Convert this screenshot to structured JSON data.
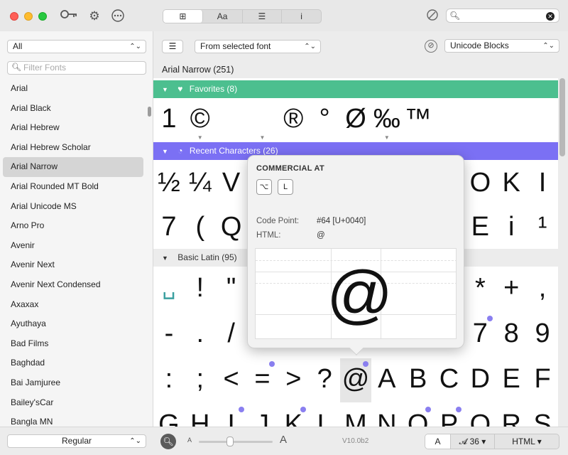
{
  "toolbar": {
    "segments": [
      "⊞",
      "Aa",
      "☰",
      "i"
    ],
    "search_value": ""
  },
  "sidebar": {
    "collection": "All",
    "filter_placeholder": "Filter Fonts",
    "fonts": [
      "Arial",
      "Arial Black",
      "Arial Hebrew",
      "Arial Hebrew Scholar",
      "Arial Narrow",
      "Arial Rounded MT Bold",
      "Arial Unicode MS",
      "Arno Pro",
      "Avenir",
      "Avenir Next",
      "Avenir Next Condensed",
      "Axaxax",
      "Ayuthaya",
      "Bad Films",
      "Baghdad",
      "Bai Jamjuree",
      "Bailey'sCar",
      "Bangla MN"
    ],
    "selected_index": 4,
    "style": "Regular"
  },
  "main": {
    "source": "From selected font",
    "blocks": "Unicode Blocks",
    "font_title": "Arial Narrow (251)",
    "sections": {
      "favorites": "Favorites (8)",
      "recent": "Recent Characters (26)",
      "basic": "Basic Latin (95)"
    },
    "fav_row": [
      "1",
      "©",
      "",
      "",
      "®",
      "°",
      "Ø",
      "‰",
      "™",
      "",
      "",
      "",
      ""
    ],
    "recent_row1": [
      "½",
      "¼",
      "V",
      "",
      "",
      "",
      "",
      "",
      "",
      "",
      "O",
      "K",
      "I"
    ],
    "recent_row2": [
      "7",
      "(",
      "Q",
      "",
      "",
      "",
      "",
      "",
      "",
      "",
      "E",
      "i",
      "¹"
    ],
    "basic_row1": [
      "␣",
      "!",
      "\"",
      "",
      "",
      "",
      "",
      "",
      "",
      "",
      "*",
      "+",
      ","
    ],
    "basic_row2": [
      "-",
      ".",
      "/",
      "",
      "",
      "",
      "",
      "",
      "",
      "",
      "7",
      "8",
      "9"
    ],
    "basic_row3": [
      ":",
      ";",
      "<",
      "=",
      ">",
      "?",
      "@",
      "A",
      "B",
      "C",
      "D",
      "E",
      "F"
    ],
    "basic_row4": [
      "G",
      "H",
      "I",
      "J",
      "K",
      "L",
      "M",
      "N",
      "O",
      "P",
      "Q",
      "R",
      "S"
    ]
  },
  "popover": {
    "name": "COMMERCIAL AT",
    "keys": [
      "⌥",
      "L"
    ],
    "code_point_label": "Code Point:",
    "code_point_value": "#64 [U+0040]",
    "html_label": "HTML:",
    "html_value": "@",
    "glyph": "@"
  },
  "bottom": {
    "zoom_min_label": "A",
    "zoom_max_label": "A",
    "zoom_level": 0.42,
    "version": "V10.0b2",
    "mode_a": "A",
    "size": "36 ▾",
    "size_icon": "𝓐",
    "format": "HTML ▾"
  },
  "colors": {
    "favorites": "#4cbf8f",
    "recent": "#7b70f4",
    "accent_dot": "#8a7ff0"
  }
}
